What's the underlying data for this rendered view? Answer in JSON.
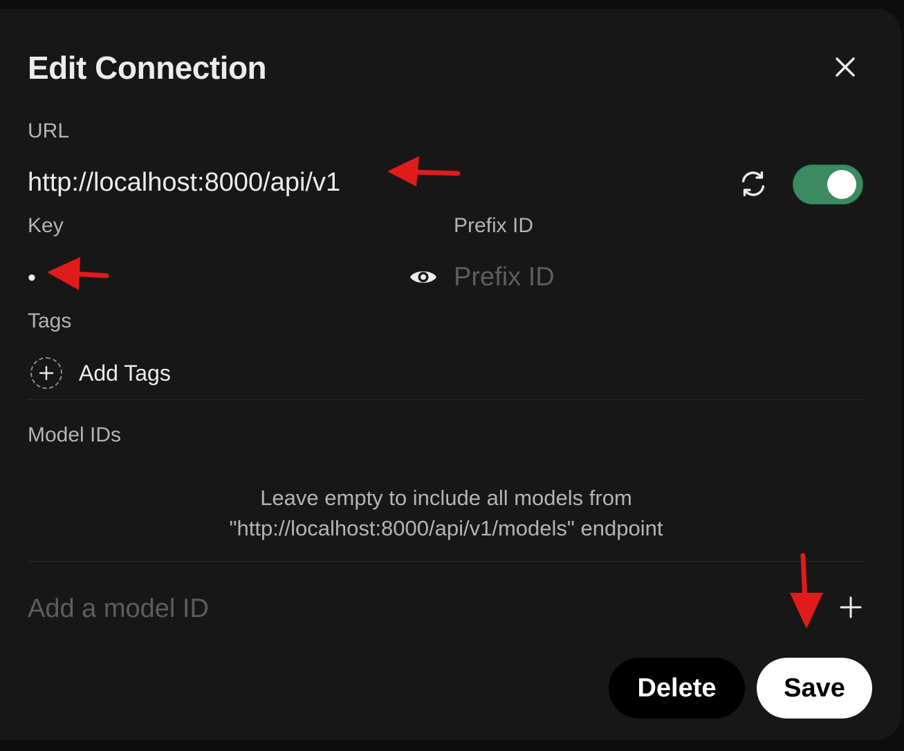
{
  "modal": {
    "title": "Edit Connection"
  },
  "url": {
    "label": "URL",
    "value": "http://localhost:8000/api/v1"
  },
  "key": {
    "label": "Key",
    "value": "•"
  },
  "prefix": {
    "label": "Prefix ID",
    "placeholder": "Prefix ID",
    "value": ""
  },
  "tags": {
    "label": "Tags",
    "add_label": "Add Tags"
  },
  "models": {
    "label": "Model IDs",
    "hint_line1": "Leave empty to include all models from",
    "hint_line2": "\"http://localhost:8000/api/v1/models\" endpoint",
    "input_placeholder": "Add a model ID"
  },
  "actions": {
    "delete_label": "Delete",
    "save_label": "Save"
  },
  "toggle": {
    "enabled": true
  },
  "colors": {
    "background": "#171717",
    "toggle_on": "#3b8a60",
    "annotation_arrow": "#e01b1b"
  },
  "icons": [
    "close-icon",
    "refresh-icon",
    "eye-icon",
    "plus-icon",
    "add-plus-icon"
  ]
}
